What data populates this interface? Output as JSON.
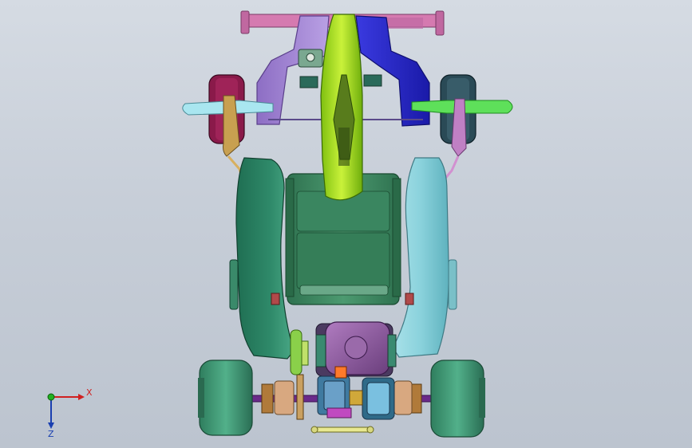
{
  "viewport": {
    "name": "cad-graphics-area",
    "colors": {
      "background_top": "#d5dbe3",
      "background_bottom": "#bcc4cf",
      "steering_column": "#a8e41e",
      "left_front_upright": "#a68ad8",
      "right_front_upright": "#2a2ad0",
      "left_side_pod": "#2f8a6a",
      "right_side_pod": "#8ad2dc",
      "seat": "#3f8a62",
      "engine": "#8a5a9a",
      "wheel": "#3a9a74",
      "front_left_wheel": "#8a1a4a",
      "front_right_wheel": "#2a4a56",
      "handlebar": "#d57ab0"
    }
  },
  "triad": {
    "x_label": "X",
    "z_label": "Z",
    "x_color": "#d02020",
    "y_color": "#20b020",
    "z_color": "#1a3fb0"
  }
}
